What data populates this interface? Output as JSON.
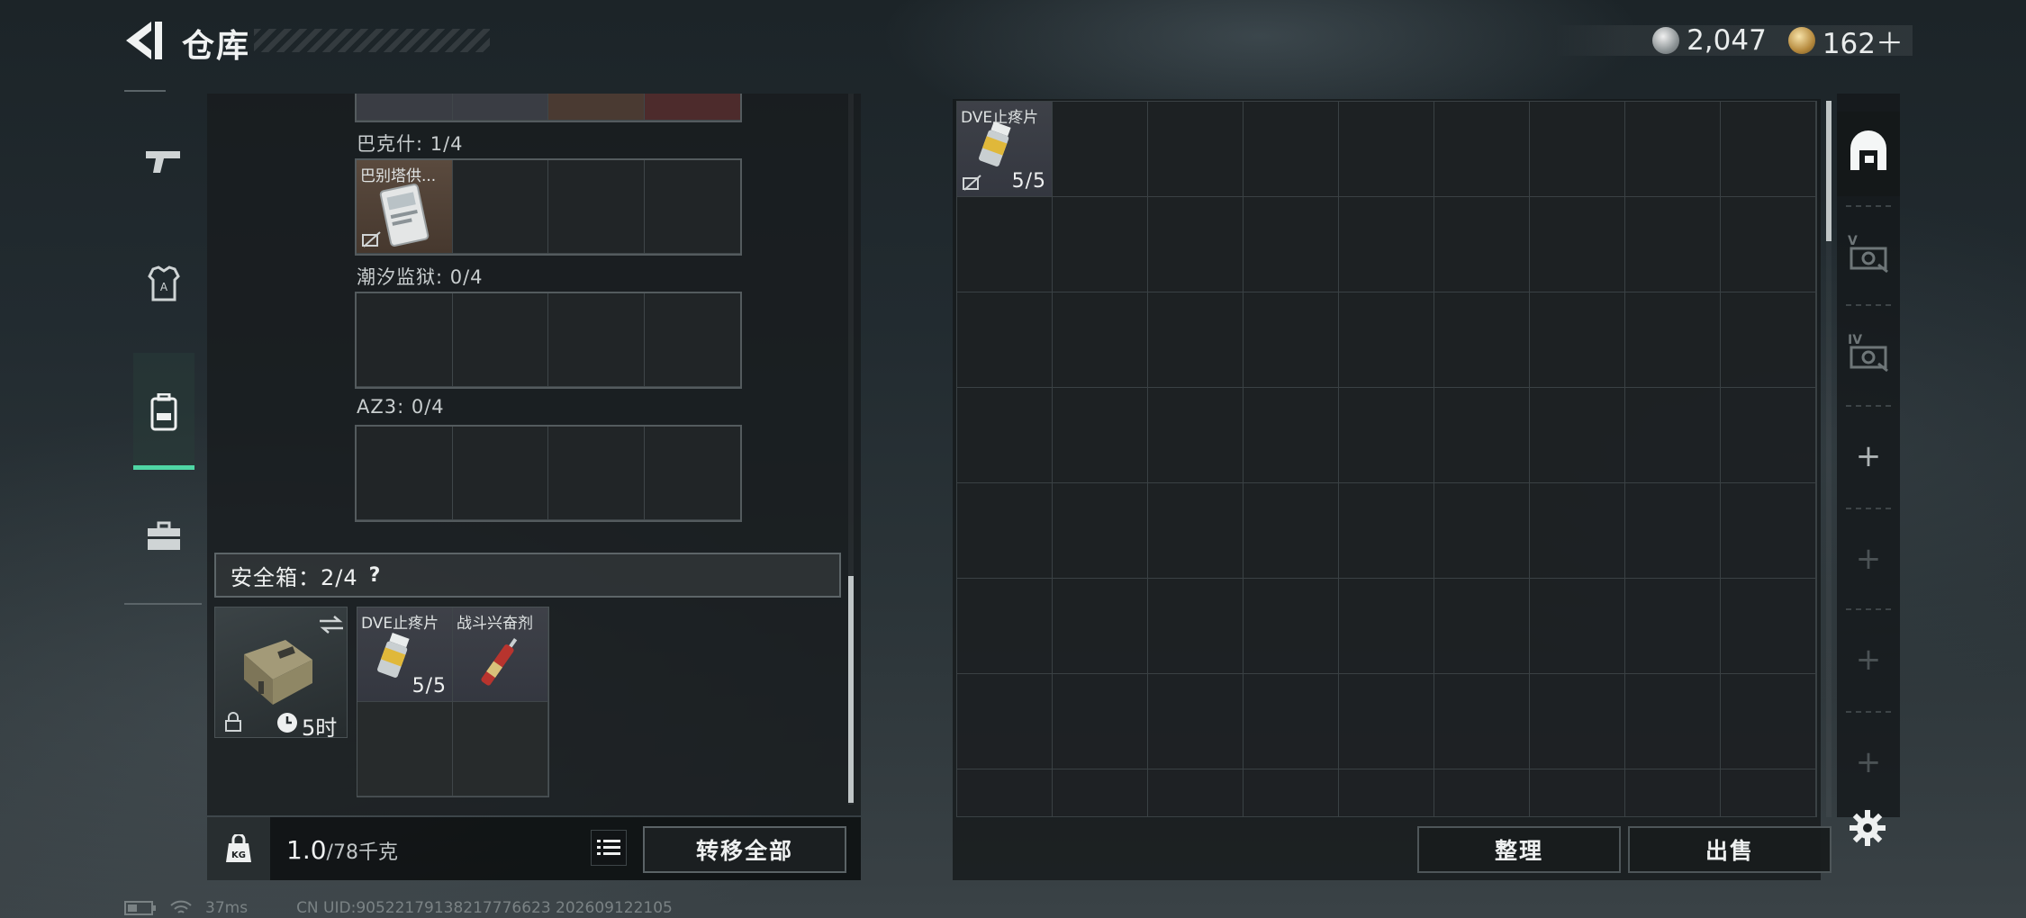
{
  "header": {
    "title": "仓库",
    "currency_silver": "2,047",
    "currency_gold": "162＋"
  },
  "left_nav": {
    "items": [
      "gun-icon",
      "armor-icon",
      "backpack-icon",
      "toolbox-icon"
    ],
    "active_index": 2
  },
  "key_rows": [
    {
      "label": "巴克什: 1/4",
      "items": [
        {
          "name": "巴别塔供..."
        }
      ]
    },
    {
      "label": "潮汐监狱: 0/4",
      "items": []
    },
    {
      "label": "AZ3: 0/4",
      "items": []
    }
  ],
  "safe_box": {
    "title": "安全箱：2/4",
    "help": "?",
    "timer": "5时",
    "items": [
      {
        "name": "DVE止疼片",
        "count": "5/5"
      },
      {
        "name": "战斗兴奋剂"
      }
    ]
  },
  "bottom_left": {
    "kg_label": "KG",
    "weight_current": "1.0",
    "weight_max": "/78千克",
    "transfer_all": "转移全部"
  },
  "stash": {
    "items": [
      {
        "name": "DVE止疼片",
        "count": "5/5"
      }
    ],
    "organize": "整理",
    "sell": "出售"
  },
  "right_tabs": {
    "tab2_label": "V",
    "tab3_label": "IV"
  },
  "status": {
    "ping": "37ms",
    "uid": "CN UID:90522179138217776623 202609122105"
  },
  "colors": {
    "accent": "#4fd6a4",
    "no_trade_strike": "#a0a6a8"
  }
}
